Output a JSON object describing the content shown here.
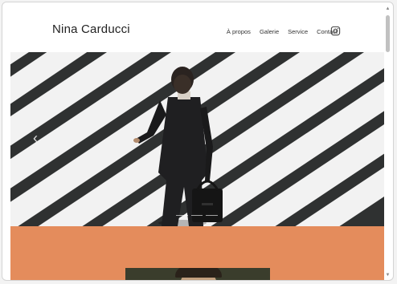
{
  "site": {
    "title": "Nina Carducci"
  },
  "nav": {
    "items": [
      "À propos",
      "Galerie",
      "Service",
      "Contact"
    ]
  },
  "social": {
    "icon": "instagram-icon"
  },
  "carousel": {
    "prev_icon": "chevron-left-icon",
    "prev_glyph": "‹",
    "slide_count": 3,
    "active_slide": 1
  },
  "colors": {
    "accent": "#e48c5c",
    "stripe_dark": "#2f3131",
    "stripe_light": "#f2f2f2"
  }
}
